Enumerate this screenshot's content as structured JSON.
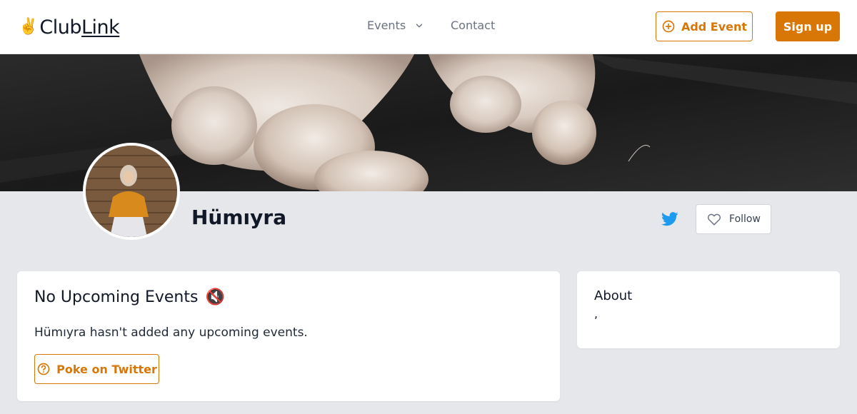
{
  "header": {
    "logo_emoji": "✌️",
    "logo_club": "Club",
    "logo_link": "Link",
    "nav": {
      "events_label": "Events",
      "contact_label": "Contact"
    },
    "add_event_label": "Add Event",
    "signup_label": "Sign up"
  },
  "profile": {
    "name": "Hümıyra",
    "follow_label": "Follow"
  },
  "events": {
    "title": "No Upcoming Events",
    "title_emoji": "🔇",
    "description": "Hümıyra hasn't added any upcoming events.",
    "poke_label": "Poke on Twitter"
  },
  "about": {
    "title": "About",
    "body": ","
  },
  "colors": {
    "accent": "#d97706",
    "twitter": "#1d9bf0",
    "background": "#e5e7eb"
  },
  "icons": [
    "chevron-down-icon",
    "plus-circle-icon",
    "twitter-icon",
    "heart-icon",
    "question-circle-icon"
  ]
}
